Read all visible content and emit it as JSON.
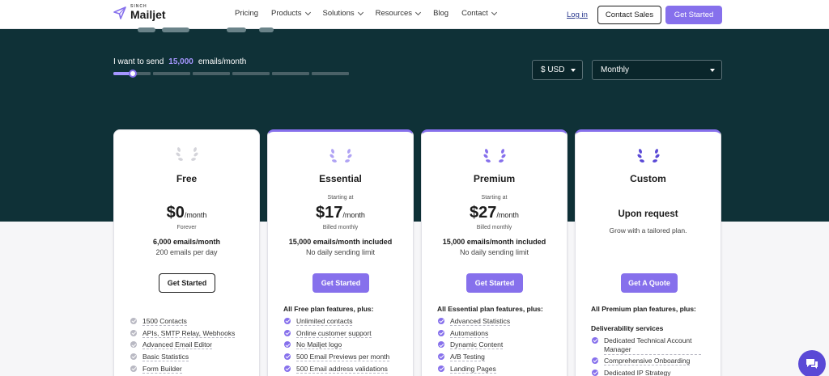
{
  "nav": {
    "logo_sinch": "SINCH",
    "logo_brand": "Mailjet",
    "menu": [
      {
        "label": "Pricing",
        "dropdown": false
      },
      {
        "label": "Products",
        "dropdown": true
      },
      {
        "label": "Solutions",
        "dropdown": true
      },
      {
        "label": "Resources",
        "dropdown": true
      },
      {
        "label": "Blog",
        "dropdown": false
      },
      {
        "label": "Contact",
        "dropdown": true
      }
    ],
    "login": "Log in",
    "contact_sales": "Contact Sales",
    "get_started": "Get Started"
  },
  "hero": {
    "send_prefix": "I want to send",
    "send_amount": "15,000",
    "send_suffix": "emails/month",
    "slider_value_fraction": 0.08,
    "currency": "$ USD",
    "period": "Monthly"
  },
  "plans": [
    {
      "name": "Free",
      "starting": "",
      "price": "$0",
      "per": "/month",
      "billing": "Forever",
      "emails": "6,000 emails/month",
      "emails_sub": "200 emails per day",
      "cta": "Get Started",
      "features_head": "",
      "features": [
        "1500 Contacts",
        "APIs, SMTP Relay, Webhooks",
        "Advanced Email Editor",
        "Basic Statistics",
        "Form Builder"
      ]
    },
    {
      "name": "Essential",
      "starting": "Starting at",
      "price": "$17",
      "per": "/month",
      "billing": "Billed monthly",
      "emails": "15,000 emails/month included",
      "emails_sub": "No daily sending limit",
      "cta": "Get Started",
      "features_head": "All Free plan features, plus:",
      "features": [
        "Unlimited contacts",
        "Online customer support",
        "No Mailjet logo",
        "500 Email Previews per month",
        "500 Email address validations"
      ]
    },
    {
      "name": "Premium",
      "starting": "Starting at",
      "price": "$27",
      "per": "/month",
      "billing": "Billed monthly",
      "emails": "15,000 emails/month included",
      "emails_sub": "No daily sending limit",
      "cta": "Get Started",
      "features_head": "All Essential plan features, plus:",
      "features": [
        "Advanced Statistics",
        "Automations",
        "Dynamic Content",
        "A/B Testing",
        "Landing Pages"
      ]
    },
    {
      "name": "Custom",
      "request": "Upon request",
      "tailored": "Grow with a tailored plan.",
      "cta": "Get A Quote",
      "features_head": "All Premium plan features, plus:",
      "sub_head": "Deliverability services",
      "features": [
        "Dedicated Technical Account Manager",
        "Comprehensive Onboarding",
        "Dedicated IP Strategy"
      ]
    }
  ],
  "colors": {
    "accent": "#8670ec",
    "hero_bg": "#0f3137",
    "check_free": "#b9b9c3"
  },
  "icons": {
    "chat": "chat-bubble-icon",
    "laurel": "laurel-wreath-icon"
  }
}
